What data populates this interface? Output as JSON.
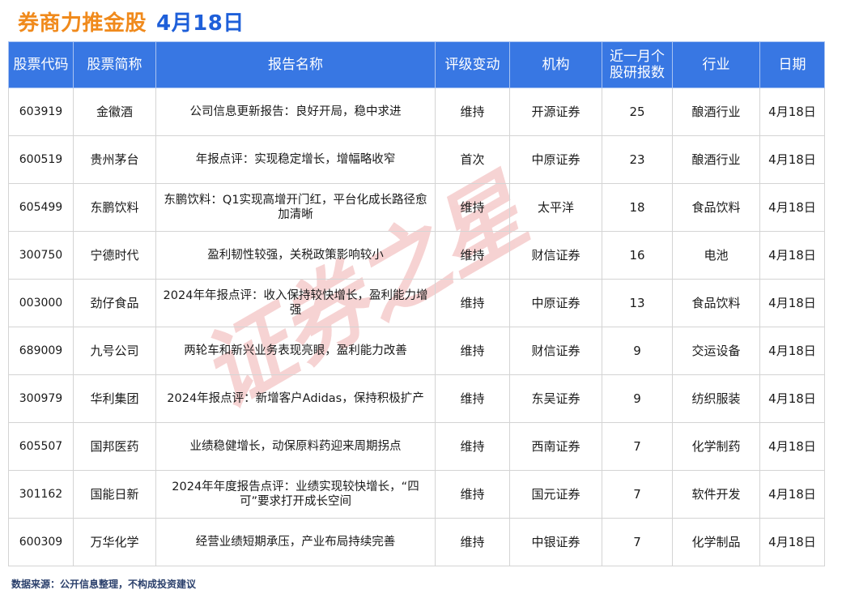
{
  "header": {
    "brand": "券商力推金股",
    "date": "4月18日"
  },
  "watermark_text": "证券之星",
  "table": {
    "columns": [
      "股票代码",
      "股票简称",
      "报告名称",
      "评级变动",
      "机构",
      "近一月个股研报数",
      "行业",
      "日期"
    ],
    "rows": [
      [
        "603919",
        "金徽酒",
        "公司信息更新报告：良好开局，稳中求进",
        "维持",
        "开源证券",
        "25",
        "酿酒行业",
        "4月18日"
      ],
      [
        "600519",
        "贵州茅台",
        "年报点评：实现稳定增长，增幅略收窄",
        "首次",
        "中原证券",
        "23",
        "酿酒行业",
        "4月18日"
      ],
      [
        "605499",
        "东鹏饮料",
        "东鹏饮料：Q1实现高增开门红，平台化成长路径愈加清晰",
        "维持",
        "太平洋",
        "18",
        "食品饮料",
        "4月18日"
      ],
      [
        "300750",
        "宁德时代",
        "盈利韧性较强，关税政策影响较小",
        "维持",
        "财信证券",
        "16",
        "电池",
        "4月18日"
      ],
      [
        "003000",
        "劲仔食品",
        "2024年年报点评：收入保持较快增长，盈利能力增强",
        "维持",
        "中原证券",
        "13",
        "食品饮料",
        "4月18日"
      ],
      [
        "689009",
        "九号公司",
        "两轮车和新兴业务表现亮眼，盈利能力改善",
        "维持",
        "财信证券",
        "9",
        "交运设备",
        "4月18日"
      ],
      [
        "300979",
        "华利集团",
        "2024年报点评：新增客户Adidas，保持积极扩产",
        "维持",
        "东吴证券",
        "9",
        "纺织服装",
        "4月18日"
      ],
      [
        "605507",
        "国邦医药",
        "业绩稳健增长，动保原料药迎来周期拐点",
        "维持",
        "西南证券",
        "7",
        "化学制药",
        "4月18日"
      ],
      [
        "301162",
        "国能日新",
        "2024年年度报告点评：业绩实现较快增长，“四可”要求打开成长空间",
        "维持",
        "国元证券",
        "7",
        "软件开发",
        "4月18日"
      ],
      [
        "600309",
        "万华化学",
        "经营业绩短期承压，产业布局持续完善",
        "维持",
        "中银证券",
        "7",
        "化学制品",
        "4月18日"
      ]
    ]
  },
  "footer": "数据来源：公开信息整理，不构成投资建议",
  "colors": {
    "brand": "#f08a1c",
    "date": "#1e5fd9",
    "header_bg": "#3877e3",
    "watermark": "#f3c4c4"
  }
}
